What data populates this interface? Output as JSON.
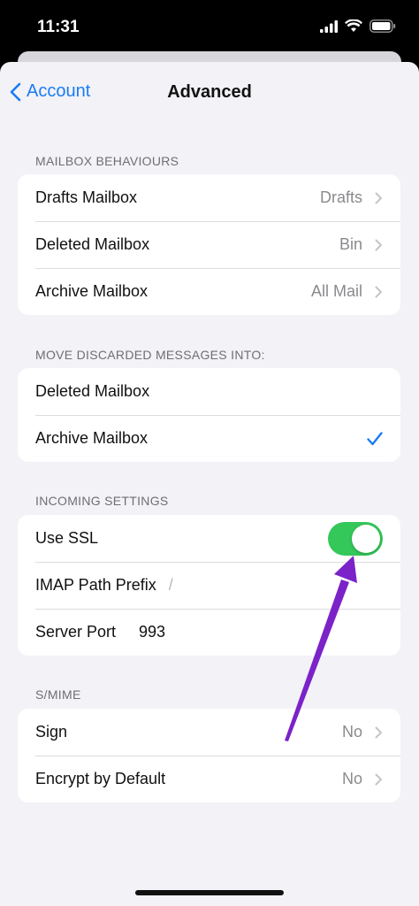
{
  "status": {
    "time": "11:31"
  },
  "nav": {
    "back_label": "Account",
    "title": "Advanced"
  },
  "mailbox_behaviours": {
    "header": "MAILBOX BEHAVIOURS",
    "rows": [
      {
        "label": "Drafts Mailbox",
        "value": "Drafts"
      },
      {
        "label": "Deleted Mailbox",
        "value": "Bin"
      },
      {
        "label": "Archive Mailbox",
        "value": "All Mail"
      }
    ]
  },
  "discarded": {
    "header": "MOVE DISCARDED MESSAGES INTO:",
    "rows": [
      {
        "label": "Deleted Mailbox",
        "selected": false
      },
      {
        "label": "Archive Mailbox",
        "selected": true
      }
    ]
  },
  "incoming": {
    "header": "INCOMING SETTINGS",
    "use_ssl_label": "Use SSL",
    "use_ssl_on": true,
    "imap_label": "IMAP Path Prefix",
    "imap_value": "/",
    "port_label": "Server Port",
    "port_value": "993"
  },
  "smime": {
    "header": "S/MIME",
    "rows": [
      {
        "label": "Sign",
        "value": "No"
      },
      {
        "label": "Encrypt by Default",
        "value": "No"
      }
    ]
  },
  "colors": {
    "accent": "#1a7cf5",
    "toggle_on": "#34c759",
    "annotation_arrow": "#7b22c9"
  }
}
